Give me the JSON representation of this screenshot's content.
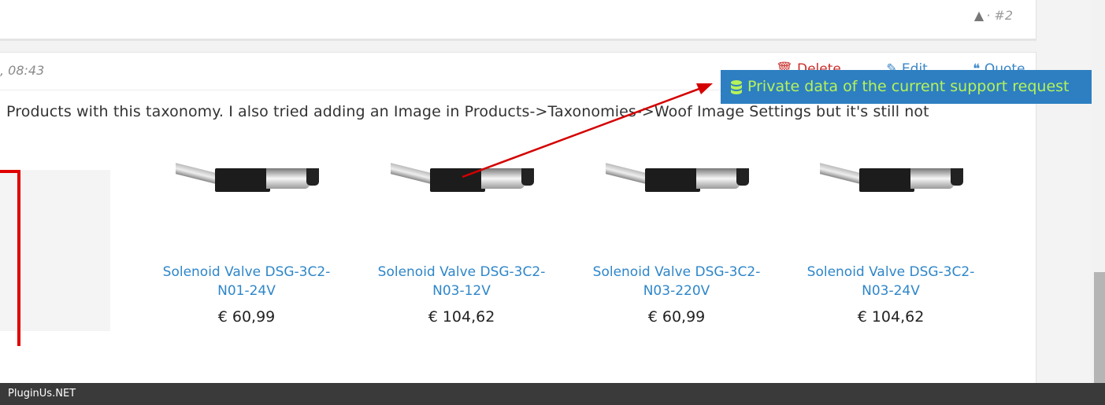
{
  "previous_post": {
    "number_text": "· #2"
  },
  "post": {
    "date_text": ", 08:43",
    "actions": {
      "delete": "Delete",
      "edit": "Edit",
      "quote": "Quote"
    },
    "text": "Products with this taxonomy. I also tried adding an Image in Products->Taxonomies->Woof Image Settings but it's still not"
  },
  "products": [
    {
      "title_line1": "Solenoid Valve DSG-3C2-",
      "title_line2": "N01-24V",
      "price": "€ 60,99"
    },
    {
      "title_line1": "Solenoid Valve DSG-3C2-",
      "title_line2": "N03-12V",
      "price": "€ 104,62"
    },
    {
      "title_line1": "Solenoid Valve DSG-3C2-",
      "title_line2": "N03-220V",
      "price": "€ 60,99"
    },
    {
      "title_line1": "Solenoid Valve DSG-3C2-",
      "title_line2": "N03-24V",
      "price": "€ 104,62"
    }
  ],
  "tooltip": {
    "text": "Private data of the current support request",
    "icon": "database-icon"
  },
  "footer": {
    "brand": "PluginUs.NET"
  },
  "colors": {
    "link": "#2e86c9",
    "tooltip_bg": "#2d7fc1",
    "tooltip_text": "#b6f25a",
    "delete": "#c9302c",
    "annotation": "#e00000"
  }
}
